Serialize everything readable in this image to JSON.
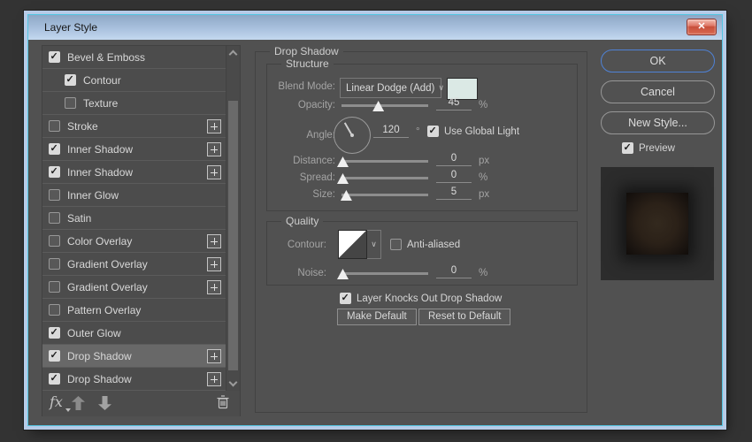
{
  "window": {
    "title": "Layer Style",
    "close_glyph": "✕"
  },
  "colors": {
    "accent_blue": "#4f82d6",
    "blend_swatch": "#dbe9e5",
    "selection_gray": "#686868",
    "frame_blue": "#b6cbe7"
  },
  "sidebar": {
    "items": [
      {
        "label": "Bevel & Emboss",
        "checked": true,
        "indent": 0,
        "plus": false,
        "selected": false
      },
      {
        "label": "Contour",
        "checked": true,
        "indent": 1,
        "plus": false,
        "selected": false
      },
      {
        "label": "Texture",
        "checked": false,
        "indent": 1,
        "plus": false,
        "selected": false
      },
      {
        "label": "Stroke",
        "checked": false,
        "indent": 0,
        "plus": true,
        "selected": false
      },
      {
        "label": "Inner Shadow",
        "checked": true,
        "indent": 0,
        "plus": true,
        "selected": false
      },
      {
        "label": "Inner Shadow",
        "checked": true,
        "indent": 0,
        "plus": true,
        "selected": false
      },
      {
        "label": "Inner Glow",
        "checked": false,
        "indent": 0,
        "plus": false,
        "selected": false
      },
      {
        "label": "Satin",
        "checked": false,
        "indent": 0,
        "plus": false,
        "selected": false
      },
      {
        "label": "Color Overlay",
        "checked": false,
        "indent": 0,
        "plus": true,
        "selected": false
      },
      {
        "label": "Gradient Overlay",
        "checked": false,
        "indent": 0,
        "plus": true,
        "selected": false
      },
      {
        "label": "Gradient Overlay",
        "checked": false,
        "indent": 0,
        "plus": true,
        "selected": false
      },
      {
        "label": "Pattern Overlay",
        "checked": false,
        "indent": 0,
        "plus": false,
        "selected": false
      },
      {
        "label": "Outer Glow",
        "checked": true,
        "indent": 0,
        "plus": false,
        "selected": false
      },
      {
        "label": "Drop Shadow",
        "checked": true,
        "indent": 0,
        "plus": true,
        "selected": true
      },
      {
        "label": "Drop Shadow",
        "checked": true,
        "indent": 0,
        "plus": true,
        "selected": false
      }
    ],
    "toolbar": {
      "fx_label": "fx"
    }
  },
  "panel": {
    "title": "Drop Shadow",
    "structure": {
      "legend": "Structure",
      "blend_mode": {
        "label": "Blend Mode:",
        "value": "Linear Dodge (Add)",
        "chevron": "∨"
      },
      "opacity": {
        "label": "Opacity:",
        "value": "45",
        "unit": "%",
        "percent": 42
      },
      "angle": {
        "label": "Angle:",
        "value": "120",
        "unit": "°",
        "checkbox_label": "Use Global Light",
        "checked": true
      },
      "distance": {
        "label": "Distance:",
        "value": "0",
        "unit": "px",
        "percent": 1
      },
      "spread": {
        "label": "Spread:",
        "value": "0",
        "unit": "%",
        "percent": 1
      },
      "size": {
        "label": "Size:",
        "value": "5",
        "unit": "px",
        "percent": 5
      }
    },
    "quality": {
      "legend": "Quality",
      "contour_label": "Contour:",
      "contour_chevron": "∨",
      "anti_aliased": {
        "label": "Anti-aliased",
        "checked": false
      },
      "noise": {
        "label": "Noise:",
        "value": "0",
        "unit": "%",
        "percent": 1
      }
    },
    "knockout": {
      "label": "Layer Knocks Out Drop Shadow",
      "checked": true
    },
    "buttons": {
      "make_default": "Make Default",
      "reset_default": "Reset to Default"
    }
  },
  "actions": {
    "ok": "OK",
    "cancel": "Cancel",
    "new_style": "New Style...",
    "preview": {
      "label": "Preview",
      "checked": true
    }
  }
}
